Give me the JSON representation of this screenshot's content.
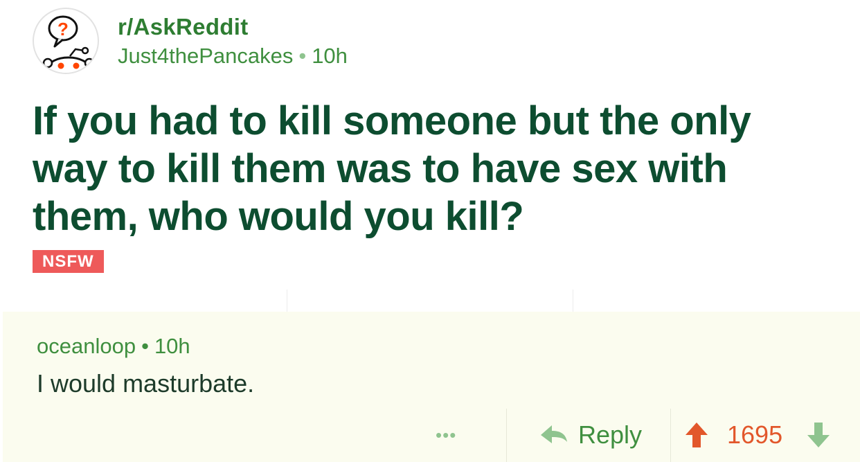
{
  "post": {
    "subreddit": "r/AskReddit",
    "author": "Just4thePancakes",
    "separator": "•",
    "age": "10h",
    "title": "If you had to kill someone but the only way to kill them was to have sex with them, who would you kill?",
    "flair": "NSFW",
    "avatar_icon": "askreddit-snoo-question-icon"
  },
  "comment": {
    "author": "oceanloop",
    "separator": "•",
    "age": "10h",
    "body": "I would masturbate.",
    "more_label": "•••",
    "reply_label": "Reply",
    "score": "1695"
  },
  "colors": {
    "title": "#0d4d30",
    "meta_green": "#3f8f3f",
    "nsfw": "#ee5a5a",
    "upvote": "#e2572b",
    "downvote": "#8fc48f",
    "comment_bg": "#fbfcef"
  }
}
